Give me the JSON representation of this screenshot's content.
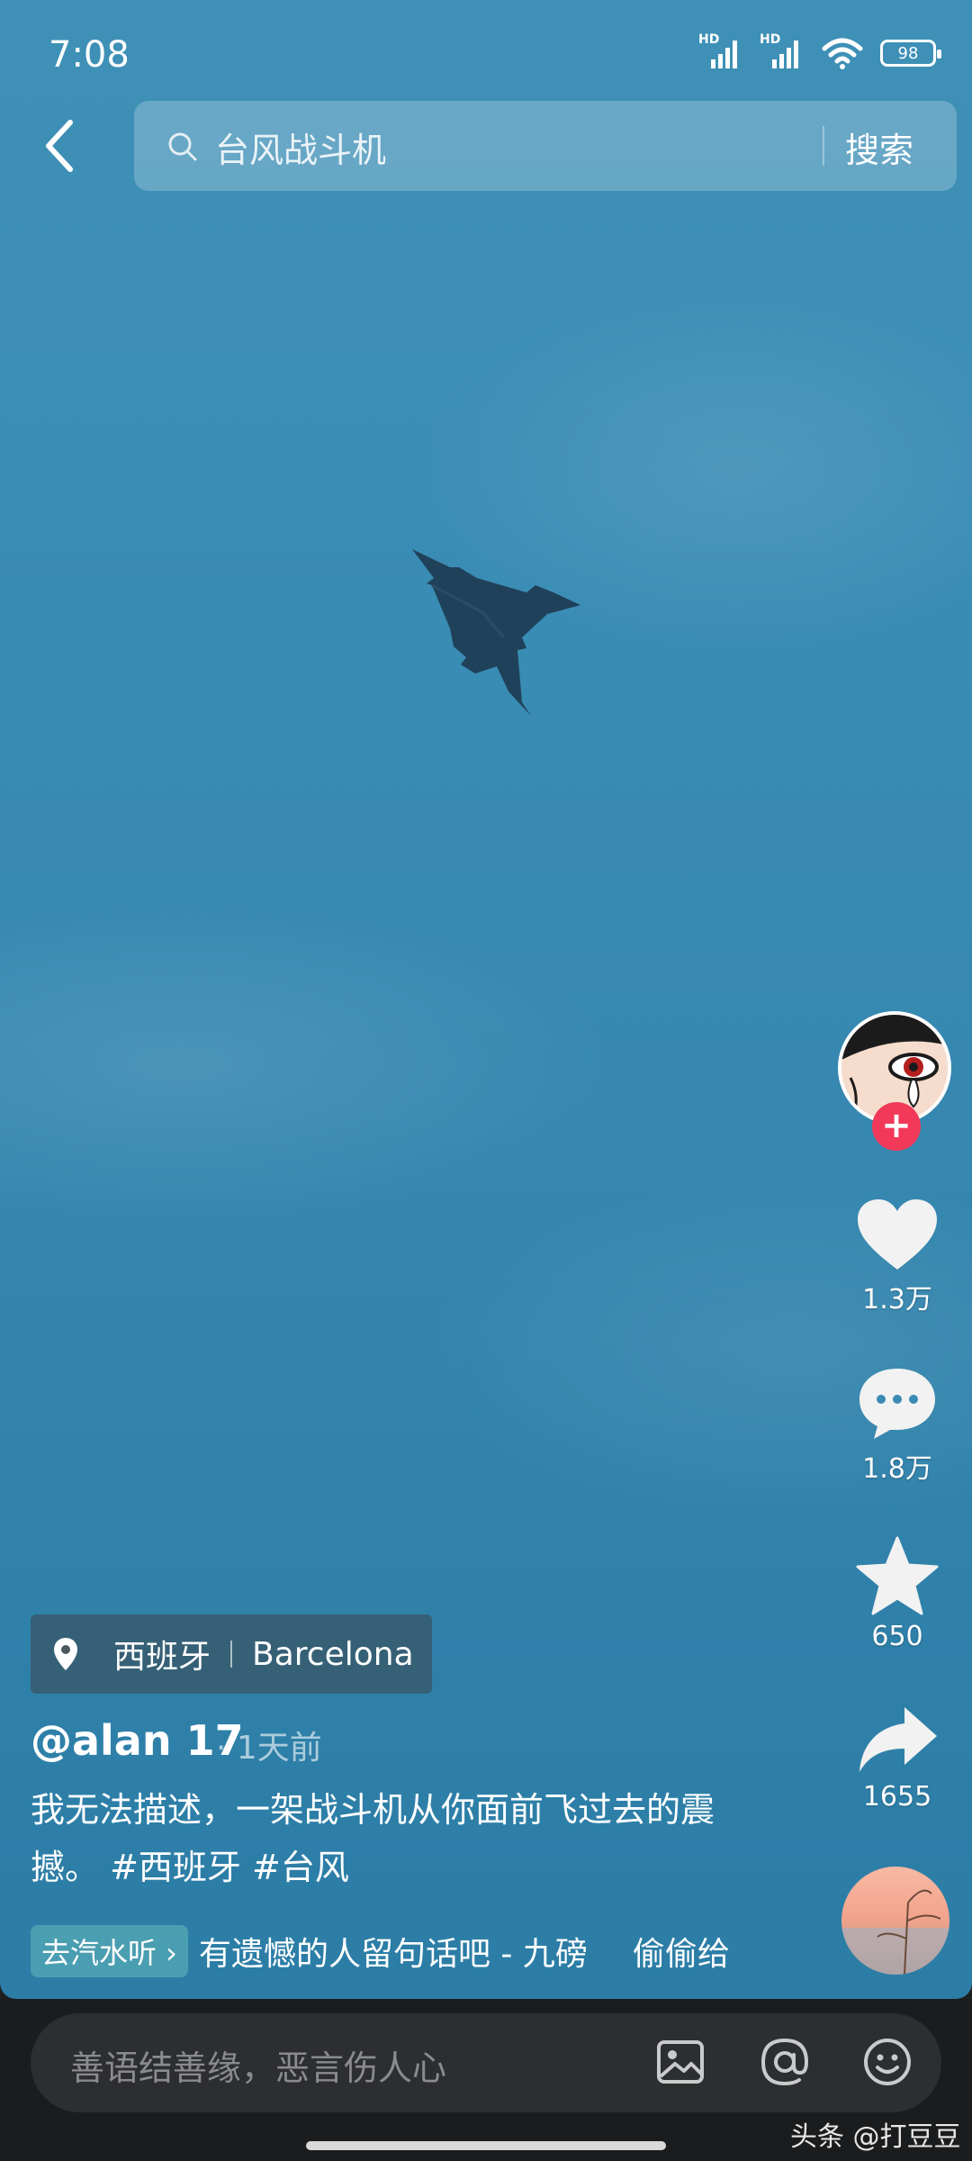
{
  "status_bar": {
    "time": "7:08",
    "signal1_label": "HD",
    "signal2_label": "HD",
    "battery": "98"
  },
  "search": {
    "query": "台风战斗机",
    "button_label": "搜索"
  },
  "rail": {
    "likes": "1.3万",
    "comments": "1.8万",
    "favorites": "650",
    "shares": "1655",
    "follow_symbol": "+"
  },
  "location": {
    "country": "西班牙",
    "city": "Barcelona"
  },
  "post": {
    "author": "@alan 17",
    "time_ago": "· 1天前",
    "caption": "我无法描述，一架战斗机从你面前飞过去的震撼。 #西班牙 #台风"
  },
  "music": {
    "tag": "去汽水听 ›",
    "title": "有遗憾的人留句话吧 - 九磅",
    "extra": "偷偷给"
  },
  "comment_box": {
    "placeholder": "善语结善缘，恶言伤人心"
  },
  "watermark": "头条 @打豆豆",
  "icons": [
    "back-icon",
    "search-icon",
    "heart-icon",
    "comment-icon",
    "star-icon",
    "share-icon",
    "location-pin-icon",
    "image-icon",
    "at-icon",
    "emoji-icon"
  ]
}
